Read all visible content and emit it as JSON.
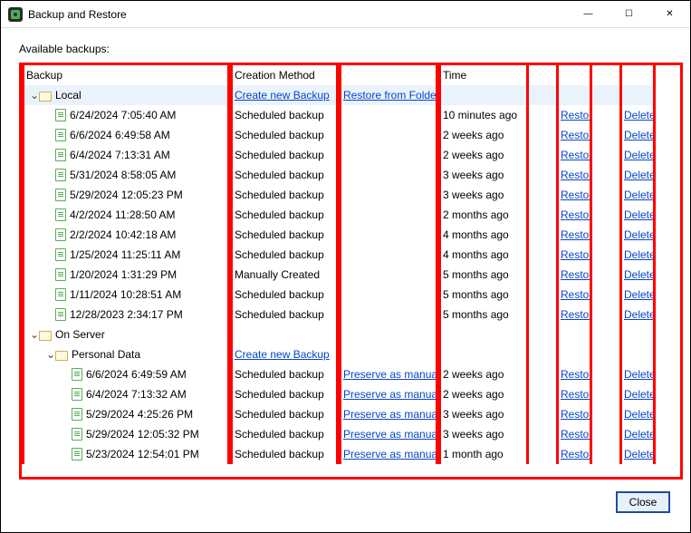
{
  "window": {
    "title": "Backup and Restore",
    "available_label": "Available backups:",
    "close_button": "Close"
  },
  "columns": {
    "backup": "Backup",
    "creation": "Creation Method",
    "preserve": "",
    "time": "Time",
    "restore": "",
    "delete": ""
  },
  "links": {
    "create_new": "Create new Backup",
    "restore_folder": "Restore from Folder",
    "preserve_manual": "Preserve as manual",
    "restore": "Restore",
    "delete": "Delete"
  },
  "groups": [
    {
      "name": "Local",
      "selected": true,
      "indent": 0,
      "show_create": true,
      "show_restore_folder": true,
      "rows": [
        {
          "date": "6/24/2024 7:05:40 AM",
          "method": "Scheduled backup",
          "time": "10 minutes ago",
          "preserve": false
        },
        {
          "date": "6/6/2024 6:49:58 AM",
          "method": "Scheduled backup",
          "time": "2 weeks ago",
          "preserve": false
        },
        {
          "date": "6/4/2024 7:13:31 AM",
          "method": "Scheduled backup",
          "time": "2 weeks ago",
          "preserve": false
        },
        {
          "date": "5/31/2024 8:58:05 AM",
          "method": "Scheduled backup",
          "time": "3 weeks ago",
          "preserve": false
        },
        {
          "date": "5/29/2024 12:05:23 PM",
          "method": "Scheduled backup",
          "time": "3 weeks ago",
          "preserve": false
        },
        {
          "date": "4/2/2024 11:28:50 AM",
          "method": "Scheduled backup",
          "time": "2 months ago",
          "preserve": false
        },
        {
          "date": "2/2/2024 10:42:18 AM",
          "method": "Scheduled backup",
          "time": "4 months ago",
          "preserve": false
        },
        {
          "date": "1/25/2024 11:25:11 AM",
          "method": "Scheduled backup",
          "time": "4 months ago",
          "preserve": false
        },
        {
          "date": "1/20/2024 1:31:29 PM",
          "method": "Manually Created",
          "time": "5 months ago",
          "preserve": false
        },
        {
          "date": "1/11/2024 10:28:51 AM",
          "method": "Scheduled backup",
          "time": "5 months ago",
          "preserve": false
        },
        {
          "date": "12/28/2023 2:34:17 PM",
          "method": "Scheduled backup",
          "time": "5 months ago",
          "preserve": false
        }
      ]
    },
    {
      "name": "On Server",
      "indent": 0,
      "show_create": false,
      "show_restore_folder": false,
      "rows": []
    },
    {
      "name": "Personal Data",
      "indent": 1,
      "show_create": true,
      "show_restore_folder": false,
      "rows": [
        {
          "date": "6/6/2024 6:49:59 AM",
          "method": "Scheduled backup",
          "time": "2 weeks ago",
          "preserve": true
        },
        {
          "date": "6/4/2024 7:13:32 AM",
          "method": "Scheduled backup",
          "time": "2 weeks ago",
          "preserve": true
        },
        {
          "date": "5/29/2024 4:25:26 PM",
          "method": "Scheduled backup",
          "time": "3 weeks ago",
          "preserve": true
        },
        {
          "date": "5/29/2024 12:05:32 PM",
          "method": "Scheduled backup",
          "time": "3 weeks ago",
          "preserve": true
        },
        {
          "date": "5/23/2024 12:54:01 PM",
          "method": "Scheduled backup",
          "time": "1 month ago",
          "preserve": true
        }
      ]
    }
  ]
}
